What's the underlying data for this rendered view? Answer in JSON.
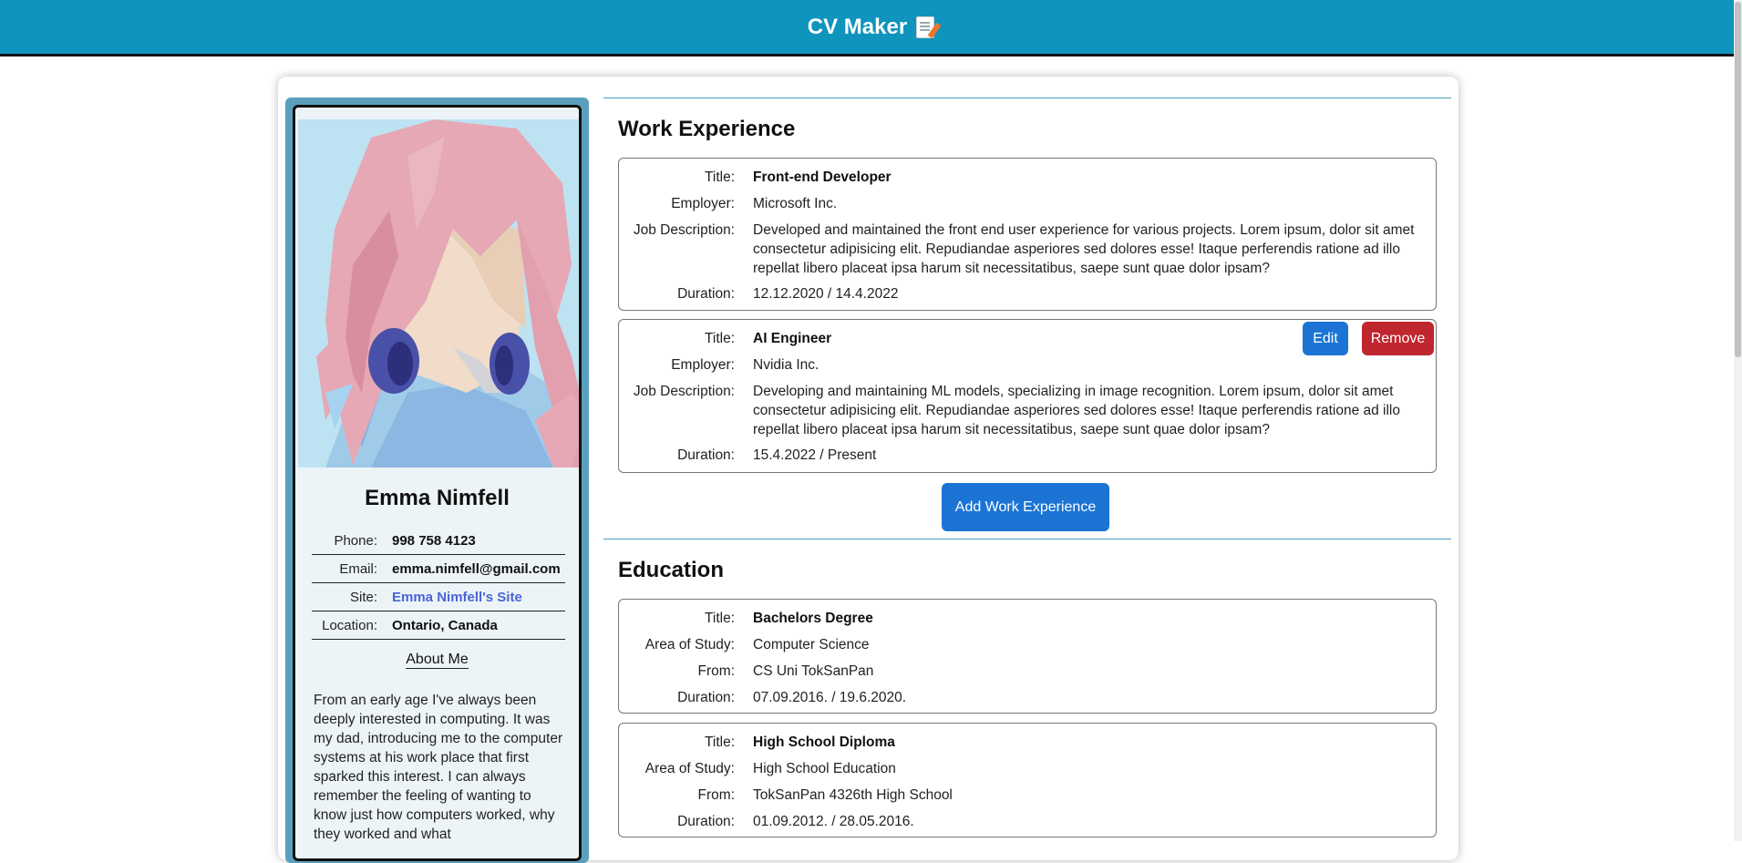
{
  "header": {
    "title": "CV Maker",
    "icon": "memo-pencil-icon"
  },
  "profile": {
    "name": "Emma Nimfell",
    "contact": [
      {
        "label": "Phone:",
        "value": "998 758 4123"
      },
      {
        "label": "Email:",
        "value": "emma.nimfell@gmail.com"
      },
      {
        "label": "Site:",
        "value": "Emma Nimfell's Site"
      },
      {
        "label": "Location:",
        "value": "Ontario, Canada"
      }
    ],
    "about_heading": "About Me",
    "about_text": "From an early age I've always been deeply interested in computing. It was my dad, introducing me to the computer systems at his work place that first sparked this interest. I can always remember the feeling of wanting to know just how computers worked, why they worked and what"
  },
  "work": {
    "heading": "Work Experience",
    "labels": {
      "title": "Title:",
      "employer": "Employer:",
      "description": "Job Description:",
      "duration": "Duration:"
    },
    "entries": [
      {
        "title": "Front-end Developer",
        "employer": "Microsoft Inc.",
        "description": "Developed and maintained the front end user experience for various projects. Lorem ipsum, dolor sit amet consectetur adipisicing elit. Repudiandae asperiores sed dolores esse! Itaque perferendis ratione ad illo repellat libero placeat ipsa harum sit necessitatibus, saepe sunt quae dolor ipsam?",
        "duration": "12.12.2020 / 14.4.2022"
      },
      {
        "title": "AI Engineer",
        "employer": "Nvidia Inc.",
        "description": "Developing and maintaining ML models, specializing in image recognition. Lorem ipsum, dolor sit amet consectetur adipisicing elit. Repudiandae asperiores sed dolores esse! Itaque perferendis ratione ad illo repellat libero placeat ipsa harum sit necessitatibus, saepe sunt quae dolor ipsam?",
        "duration": "15.4.2022 / Present"
      }
    ],
    "edit_label": "Edit",
    "remove_label": "Remove",
    "add_label": "Add Work Experience"
  },
  "education": {
    "heading": "Education",
    "labels": {
      "title": "Title:",
      "area": "Area of Study:",
      "from": "From:",
      "duration": "Duration:"
    },
    "entries": [
      {
        "title": "Bachelors Degree",
        "area": "Computer Science",
        "from": "CS Uni TokSanPan",
        "duration": "07.09.2016. / 19.6.2020."
      },
      {
        "title": "High School Diploma",
        "area": "High School Education",
        "from": "TokSanPan 4326th High School",
        "duration": "01.09.2012. / 28.05.2016."
      }
    ]
  },
  "colors": {
    "header": "#0e94bd",
    "profile_frame": "#5aa0bd",
    "button_primary": "#1b74d4",
    "button_danger": "#c0262e",
    "link": "#4a63d6"
  }
}
